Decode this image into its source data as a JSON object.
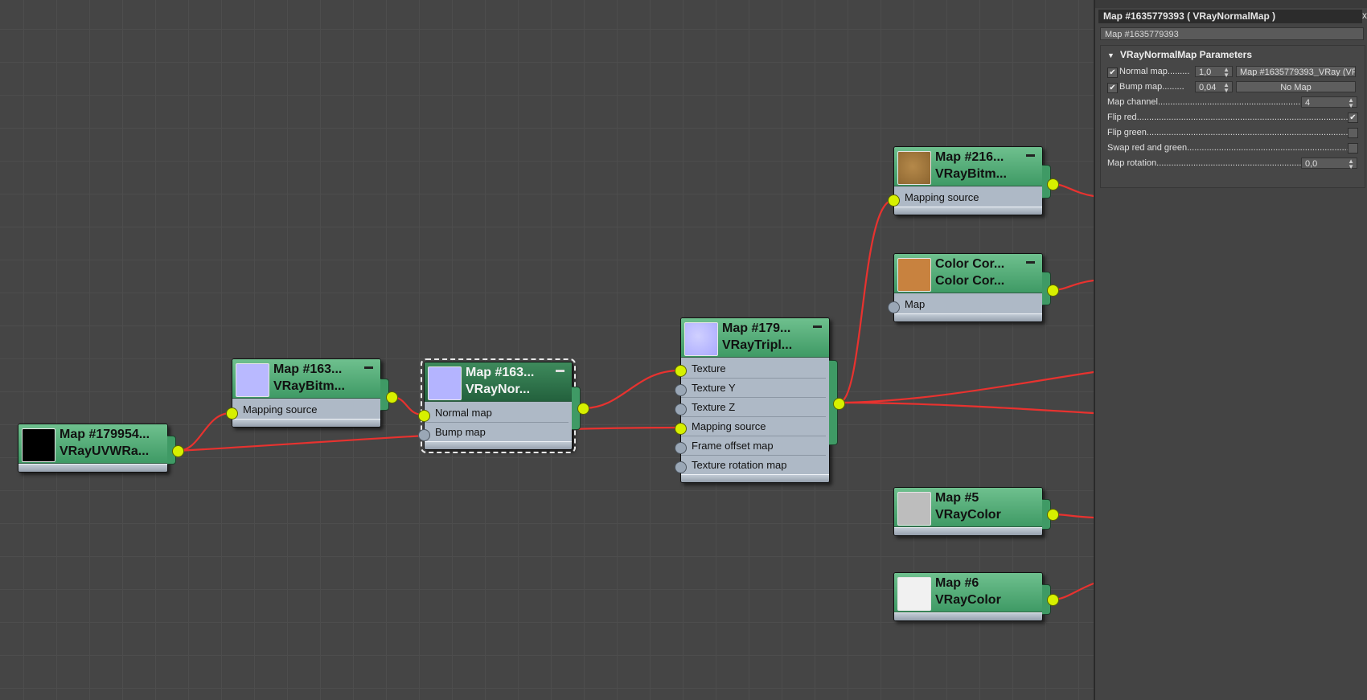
{
  "nodes": {
    "uvw": {
      "name": "Map #179954...",
      "type": "VRayUVWRa..."
    },
    "bitmap1": {
      "name": "Map #163...",
      "type": "VRayBitm...",
      "slots": [
        "Mapping source"
      ]
    },
    "normal": {
      "name": "Map #163...",
      "type": "VRayNor...",
      "slots": [
        "Normal map",
        "Bump map"
      ]
    },
    "triplanar": {
      "name": "Map #179...",
      "type": "VRayTripl...",
      "slots": [
        "Texture",
        "Texture Y",
        "Texture Z",
        "Mapping source",
        "Frame offset map",
        "Texture rotation map"
      ]
    },
    "bitmap2": {
      "name": "Map #216...",
      "type": "VRayBitm...",
      "slots": [
        "Mapping source"
      ]
    },
    "colorcorrect": {
      "name": "Color Cor...",
      "type": "Color Cor...",
      "slots": [
        "Map"
      ]
    },
    "color5": {
      "name": "Map #5",
      "type": "VRayColor"
    },
    "color6": {
      "name": "Map #6",
      "type": "VRayColor"
    }
  },
  "colors": {
    "node_header": "#4fae76",
    "node_header_selected": "#2f7149",
    "wire": "#e8322f",
    "port_connected": "#d7f000",
    "port_empty": "#9aa7b6",
    "thumb_black": "#000000",
    "thumb_normal": "#b4b4ff",
    "thumb_wood": "#a57a3e",
    "thumb_orange": "#c8823f",
    "thumb_gray": "#bdbdbd",
    "thumb_white": "#f1f1f1"
  },
  "panel": {
    "title": "Map #1635779393  ( VRayNormalMap )",
    "close": "x",
    "name_field": "Map #1635779393",
    "rollout_title": "VRayNormalMap Parameters",
    "normal_map_label": "Normal map.........",
    "normal_map_amount": "1,0",
    "normal_map_button": "Map #1635779393_VRay  (VR",
    "bump_map_label": "Bump map.........",
    "bump_map_amount": "0,04",
    "bump_map_button": "No Map",
    "map_channel_label": "Map channel.................................................................",
    "map_channel_value": "4",
    "flip_red_label": "Flip red.........................................................................................",
    "flip_green_label": "Flip green.....................................................................................",
    "swap_label": "Swap red and green........................................................................",
    "map_rotation_label": "Map rotation.................................................................",
    "map_rotation_value": "0,0",
    "check_mark": "✔"
  }
}
